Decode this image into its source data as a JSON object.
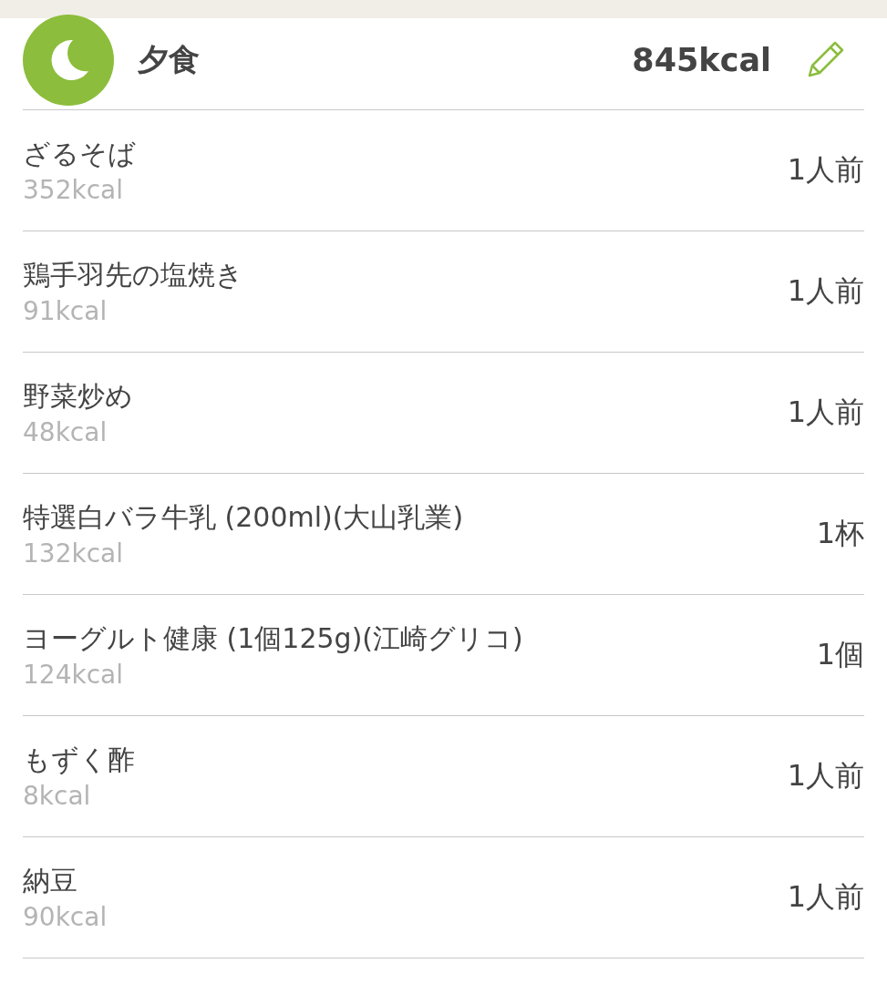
{
  "meal": {
    "title": "夕食",
    "total": "845kcal"
  },
  "items": [
    {
      "name": "ざるそば",
      "kcal": "352kcal",
      "portion": "1人前"
    },
    {
      "name": "鶏手羽先の塩焼き",
      "kcal": "91kcal",
      "portion": "1人前"
    },
    {
      "name": "野菜炒め",
      "kcal": "48kcal",
      "portion": "1人前"
    },
    {
      "name": "特選白バラ牛乳 (200ml)(大山乳業)",
      "kcal": "132kcal",
      "portion": "1杯"
    },
    {
      "name": "ヨーグルト健康 (1個125g)(江崎グリコ)",
      "kcal": "124kcal",
      "portion": "1個"
    },
    {
      "name": "もずく酢",
      "kcal": "8kcal",
      "portion": "1人前"
    },
    {
      "name": "納豆",
      "kcal": "90kcal",
      "portion": "1人前"
    }
  ]
}
